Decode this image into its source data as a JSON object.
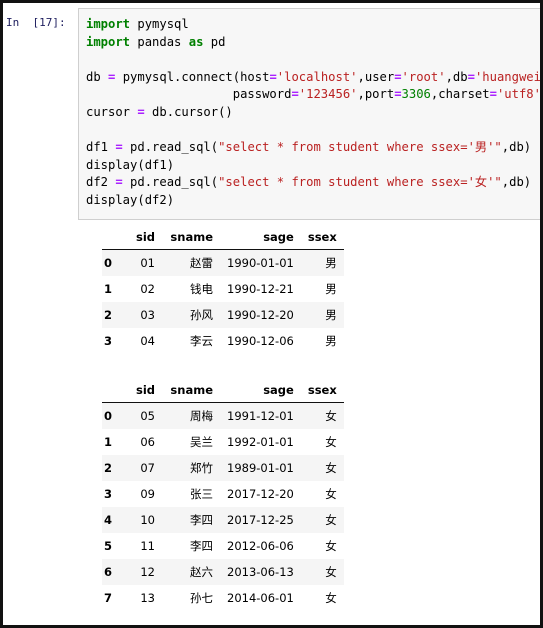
{
  "notebook": {
    "prompt_label": "In  [17]:",
    "code_lines": [
      [
        {
          "t": "import",
          "c": "kw"
        },
        {
          "t": " pymysql",
          "c": "pln"
        }
      ],
      [
        {
          "t": "import",
          "c": "kw"
        },
        {
          "t": " pandas ",
          "c": "pln"
        },
        {
          "t": "as",
          "c": "kw"
        },
        {
          "t": " pd",
          "c": "pln"
        }
      ],
      [],
      [
        {
          "t": "db ",
          "c": "pln"
        },
        {
          "t": "=",
          "c": "op"
        },
        {
          "t": " pymysql.connect(host",
          "c": "pln"
        },
        {
          "t": "=",
          "c": "op"
        },
        {
          "t": "'localhost'",
          "c": "str"
        },
        {
          "t": ",user",
          "c": "pln"
        },
        {
          "t": "=",
          "c": "op"
        },
        {
          "t": "'root'",
          "c": "str"
        },
        {
          "t": ",db",
          "c": "pln"
        },
        {
          "t": "=",
          "c": "op"
        },
        {
          "t": "'huangwei'",
          "c": "str"
        },
        {
          "t": ",",
          "c": "pln"
        }
      ],
      [
        {
          "t": "                    password",
          "c": "pln"
        },
        {
          "t": "=",
          "c": "op"
        },
        {
          "t": "'123456'",
          "c": "str"
        },
        {
          "t": ",port",
          "c": "pln"
        },
        {
          "t": "=",
          "c": "op"
        },
        {
          "t": "3306",
          "c": "num"
        },
        {
          "t": ",charset",
          "c": "pln"
        },
        {
          "t": "=",
          "c": "op"
        },
        {
          "t": "'utf8'",
          "c": "str"
        },
        {
          "t": ")",
          "c": "pln"
        }
      ],
      [
        {
          "t": "cursor ",
          "c": "pln"
        },
        {
          "t": "=",
          "c": "op"
        },
        {
          "t": " db.cursor()",
          "c": "pln"
        }
      ],
      [],
      [
        {
          "t": "df1 ",
          "c": "pln"
        },
        {
          "t": "=",
          "c": "op"
        },
        {
          "t": " pd.read_sql(",
          "c": "pln"
        },
        {
          "t": "\"select * from student where ssex='男'\"",
          "c": "str"
        },
        {
          "t": ",db)",
          "c": "pln"
        }
      ],
      [
        {
          "t": "display(df1)",
          "c": "pln"
        }
      ],
      [
        {
          "t": "df2 ",
          "c": "pln"
        },
        {
          "t": "=",
          "c": "op"
        },
        {
          "t": " pd.read_sql(",
          "c": "pln"
        },
        {
          "t": "\"select * from student where ssex='女'\"",
          "c": "str"
        },
        {
          "t": ",db)",
          "c": "pln"
        }
      ],
      [
        {
          "t": "display(df2)",
          "c": "pln"
        }
      ]
    ]
  },
  "outputs": [
    {
      "name": "df1",
      "columns": [
        "sid",
        "sname",
        "sage",
        "ssex"
      ],
      "index": [
        "0",
        "1",
        "2",
        "3"
      ],
      "rows": [
        [
          "01",
          "赵雷",
          "1990-01-01",
          "男"
        ],
        [
          "02",
          "钱电",
          "1990-12-21",
          "男"
        ],
        [
          "03",
          "孙风",
          "1990-12-20",
          "男"
        ],
        [
          "04",
          "李云",
          "1990-12-06",
          "男"
        ]
      ]
    },
    {
      "name": "df2",
      "columns": [
        "sid",
        "sname",
        "sage",
        "ssex"
      ],
      "index": [
        "0",
        "1",
        "2",
        "3",
        "4",
        "5",
        "6",
        "7"
      ],
      "rows": [
        [
          "05",
          "周梅",
          "1991-12-01",
          "女"
        ],
        [
          "06",
          "吴兰",
          "1992-01-01",
          "女"
        ],
        [
          "07",
          "郑竹",
          "1989-01-01",
          "女"
        ],
        [
          "09",
          "张三",
          "2017-12-20",
          "女"
        ],
        [
          "10",
          "李四",
          "2017-12-25",
          "女"
        ],
        [
          "11",
          "李四",
          "2012-06-06",
          "女"
        ],
        [
          "12",
          "赵六",
          "2013-06-13",
          "女"
        ],
        [
          "13",
          "孙七",
          "2014-06-01",
          "女"
        ]
      ]
    }
  ],
  "colors": {
    "keyword": "#008000",
    "string": "#ba2121",
    "number": "#008000",
    "operator": "#aa22ff",
    "prompt": "#202060",
    "cell_background": "#f7f7f7",
    "cell_border": "#cfcfcf",
    "row_stripe": "#f5f5f5",
    "page_border": "#111111"
  }
}
